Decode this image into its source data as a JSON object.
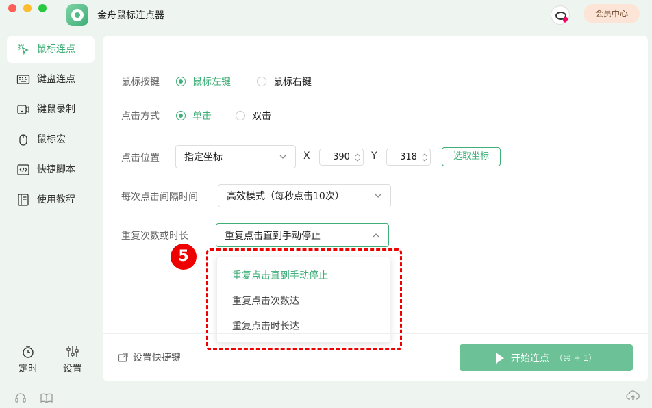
{
  "app": {
    "title": "金舟鼠标连点器",
    "vip_label": "会员中心"
  },
  "sidebar": {
    "items": [
      {
        "label": "鼠标连点",
        "icon": "cursor-click-icon"
      },
      {
        "label": "键盘连点",
        "icon": "keyboard-icon"
      },
      {
        "label": "键鼠录制",
        "icon": "record-icon"
      },
      {
        "label": "鼠标宏",
        "icon": "mouse-icon"
      },
      {
        "label": "快捷脚本",
        "icon": "script-icon"
      },
      {
        "label": "使用教程",
        "icon": "book-icon"
      }
    ],
    "tools": {
      "timer": "定时",
      "settings": "设置"
    }
  },
  "form": {
    "mouse_button": {
      "label": "鼠标按键",
      "left": "鼠标左键",
      "right": "鼠标右键",
      "selected": "left"
    },
    "click_mode": {
      "label": "点击方式",
      "single": "单击",
      "double": "双击",
      "selected": "single"
    },
    "position": {
      "label": "点击位置",
      "mode": "指定坐标",
      "x_label": "X",
      "x": "390",
      "y_label": "Y",
      "y": "318",
      "pick_label": "选取坐标"
    },
    "interval": {
      "label": "每次点击间隔时间",
      "value": "高效模式（每秒点击10次）"
    },
    "repeat": {
      "label": "重复次数或时长",
      "value": "重复点击直到手动停止"
    }
  },
  "dropdown": {
    "options": [
      "重复点击直到手动停止",
      "重复点击次数达",
      "重复点击时长达"
    ],
    "selected_index": 0
  },
  "annotation": {
    "step_number": "5",
    "color": "#e00000"
  },
  "footer": {
    "shortcut_label": "设置快捷键",
    "start_label": "开始连点",
    "start_hint": "（⌘ + 1）"
  },
  "colors": {
    "accent": "#3fae78",
    "start_button": "#6cc296"
  }
}
